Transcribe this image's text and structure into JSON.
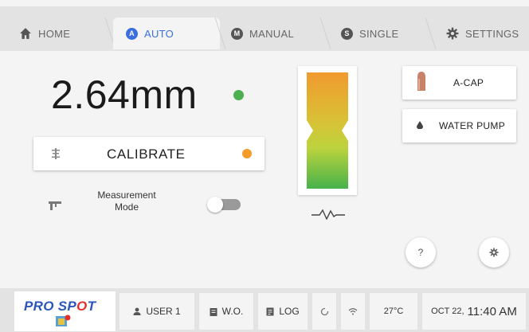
{
  "tabs": [
    {
      "label": "HOME",
      "icon": "home-icon"
    },
    {
      "label": "AUTO",
      "icon": "auto-icon",
      "badge": "A",
      "active": true
    },
    {
      "label": "MANUAL",
      "icon": "manual-icon",
      "badge": "M"
    },
    {
      "label": "SINGLE",
      "icon": "single-icon",
      "badge": "S"
    },
    {
      "label": "SETTINGS",
      "icon": "gear-icon"
    }
  ],
  "measurement": {
    "value": "2.64mm",
    "status": "ok"
  },
  "calibrate": {
    "label": "CALIBRATE",
    "status": "warning"
  },
  "measurement_mode": {
    "label_line1": "Measurement",
    "label_line2": "Mode",
    "enabled": false
  },
  "side_buttons": {
    "acap": "A-CAP",
    "water_pump": "WATER PUMP"
  },
  "help_button": {
    "label": "?"
  },
  "status_bar": {
    "logo_text_pre": "PRO SP",
    "logo_text_o": "O",
    "logo_text_post": "T",
    "user": "USER 1",
    "work_order": "W.O.",
    "log": "LOG",
    "temperature": "27°C",
    "date": "OCT 22,",
    "time": "11:40 AM"
  },
  "colors": {
    "accent": "#3b6fe0",
    "ok": "#4caf50",
    "warning": "#f59b2a",
    "brand": "#2a57b8"
  }
}
